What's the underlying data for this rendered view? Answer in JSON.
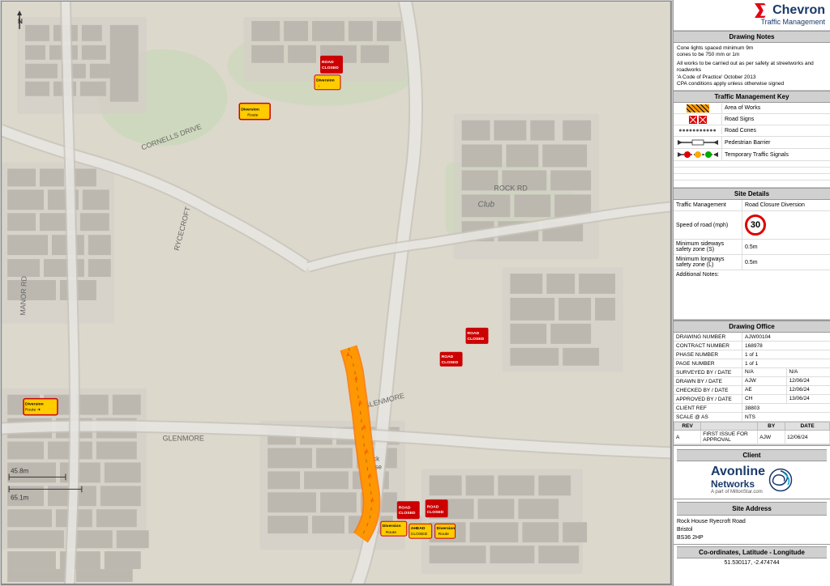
{
  "header": {
    "brand_name": "Chevron",
    "brand_subtitle": "Traffic Management"
  },
  "drawing_notes": {
    "title": "Drawing Notes",
    "note1": "Cone lights spaced minimum 9m",
    "note1b": "cones to be 750 mm or 1m",
    "note2": "All works to be carried out as per safety at streetworks and roadworks",
    "note2b": "'A Code of Practice' October 2013",
    "note3": "CPA conditions apply unless otherwise signed"
  },
  "traffic_key": {
    "title": "Traffic Management Key",
    "items": [
      {
        "id": "area-of-works",
        "label": "Area of Works"
      },
      {
        "id": "road-signs",
        "label": "Road Signs"
      },
      {
        "id": "road-cones",
        "label": "Road Cones"
      },
      {
        "id": "ped-barrier",
        "label": "Pedestrian Barrier"
      },
      {
        "id": "temp-traffic-signals",
        "label": "Temporary Traffic Signals"
      }
    ]
  },
  "site_details": {
    "title": "Site Details",
    "traffic_management_label": "Traffic Management",
    "traffic_management_value": "Road Closure Diversion",
    "speed_label": "Speed of road (mph)",
    "speed_value": "30",
    "min_sideways_label": "Minimum sideways safety zone (S)",
    "min_sideways_value": "0.5m",
    "min_longways_label": "Minimum longways safety zone (L)",
    "min_longways_value": "0.5m",
    "additional_notes_label": "Additional Notes:"
  },
  "drawing_office": {
    "title": "Drawing Office",
    "rows": [
      {
        "label": "DRAWING NUMBER",
        "value": "AJW00104"
      },
      {
        "label": "CONTRACT NUMBER",
        "value": "168978"
      },
      {
        "label": "PHASE NUMBER",
        "value": "1 of 1"
      },
      {
        "label": "PAGE NUMBER",
        "value": "1 of 1"
      },
      {
        "label": "SURVEYED BY / DATE",
        "v1": "N/A",
        "v2": "N/A"
      },
      {
        "label": "DRAWN BY / DATE",
        "v1": "AJW",
        "v2": "12/06/24"
      },
      {
        "label": "CHECKED BY / DATE",
        "v1": "AE",
        "v2": "12/06/24"
      },
      {
        "label": "APPROVED BY / DATE",
        "v1": "CH",
        "v2": "13/06/24"
      },
      {
        "label": "CLIENT REF",
        "value": "38803"
      },
      {
        "label": "SCALE @ AS",
        "value": "NTS"
      }
    ],
    "rev_headers": [
      "REV",
      "BY",
      "DATE"
    ],
    "rev_rows": [
      {
        "rev": "A",
        "desc": "FIRST ISSUE FOR APPROVAL",
        "by": "AJW",
        "date": "12/06/24"
      }
    ]
  },
  "client": {
    "title": "Client",
    "name": "Avonline",
    "networks": "Networks",
    "sub": "A part of MiltonStar.com"
  },
  "site_address": {
    "title": "Site Address",
    "line1": "Rock House Ryecroft Road",
    "line2": "Bristol",
    "line3": "BS36 2HP"
  },
  "coordinates": {
    "title": "Co-ordinates, Latitude - Longitude",
    "value": "51.530117, -2.474744"
  }
}
